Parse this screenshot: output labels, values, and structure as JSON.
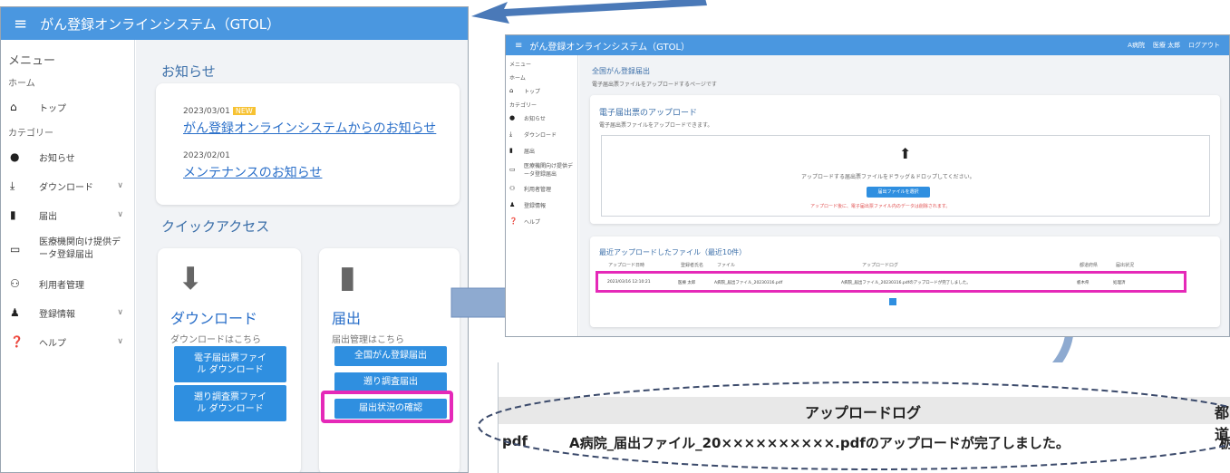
{
  "left": {
    "app_title": "がん登録オンラインシステム（GTOL）",
    "menu_title": "メニュー",
    "sec_home": "ホーム",
    "top": "トップ",
    "sec_category": "カテゴリー",
    "sidebar_items": [
      "お知らせ",
      "ダウンロード",
      "届出",
      "医療機関向け提供データ登録届出",
      "利用者管理",
      "登録情報",
      "ヘルプ"
    ],
    "news_title": "お知らせ",
    "news": [
      {
        "date": "2023/03/01",
        "badge": "NEW",
        "text": "がん登録オンラインシステムからのお知らせ"
      },
      {
        "date": "2023/02/01",
        "badge": "",
        "text": "メンテナンスのお知らせ"
      }
    ],
    "quick_title": "クイックアクセス",
    "download": {
      "title": "ダウンロード",
      "sub": "ダウンロードはこちら",
      "btn1": "電子届出票ファイル ダウンロード",
      "btn2": "遡り調査票ファイル ダウンロード"
    },
    "submit": {
      "title": "届出",
      "sub": "届出管理はこちら",
      "btn1": "全国がん登録届出",
      "btn2": "遡り調査届出",
      "btn3": "届出状況の確認"
    }
  },
  "right": {
    "app_title": "がん登録オンラインシステム（GTOL）",
    "user_hospital": "A病院",
    "user_name": "医療 太郎",
    "logout": "ログアウト",
    "menu_title": "メニュー",
    "sec_home": "ホーム",
    "top": "トップ",
    "sec_category": "カテゴリー",
    "sidebar_items": [
      "お知らせ",
      "ダウンロード",
      "届出",
      "医療機関向け提供データ登録届出",
      "利用者管理",
      "登録情報",
      "ヘルプ"
    ],
    "page_title": "全国がん登録届出",
    "page_sub": "電子届出票ファイルをアップロードするページです",
    "upload_title": "電子届出票のアップロード",
    "upload_sub": "電子届出票ファイルをアップロードできます。",
    "drop_text": "アップロードする届出票ファイルをドラッグ＆ドロップしてください。",
    "select_btn": "届出ファイルを選択",
    "warn": "アップロード後に、電子届出票ファイル内のデータは削除されます。",
    "recent_title": "最近アップロードしたファイル（最近10件）",
    "cols": [
      "アップロード日時",
      "登録者氏名",
      "ファイル",
      "アップロードログ",
      "都道府県",
      "届出状況"
    ],
    "row": [
      "2023/03/16 12:10:21",
      "医療 太郎",
      "A病院_届出ファイル_20230316.pdf",
      "A病院_届出ファイル_20230316.pdfのアップロードが完了しました。",
      "栃木県",
      "処理済"
    ]
  },
  "zoom": {
    "header": "アップロードログ",
    "header_cut": "都道",
    "pdf": "pdf",
    "message": "A病院_届出ファイル_20××××××××××.pdfのアップロードが完了しました。",
    "cut": "栃"
  },
  "colors": {
    "appbar": "#4a97e0",
    "highlight": "#e529b8",
    "arrow": "#8eaad0",
    "button": "#2f8fe0"
  }
}
